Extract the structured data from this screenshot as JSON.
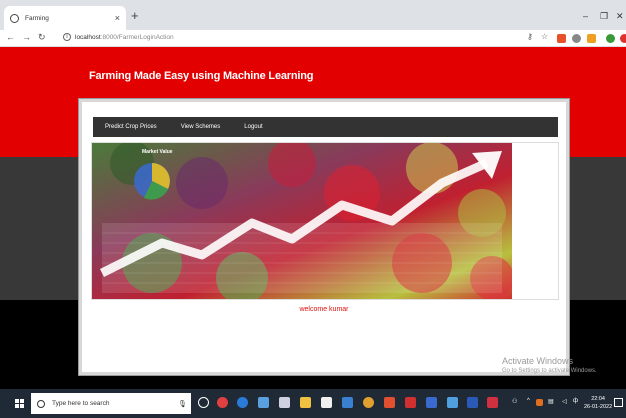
{
  "browser": {
    "tab_title": "Farming",
    "tab_close": "×",
    "new_tab": "+",
    "url_host": "localhost",
    "url_path": ":8000/FarmerLoginAction",
    "window_min": "–",
    "window_max": "❐",
    "window_close": "✕"
  },
  "site": {
    "title": "Farming Made Easy using Machine Learning",
    "nav": [
      "Predict Crop Prices",
      "View Schemes",
      "Logout"
    ],
    "hero_title": "Market Value",
    "welcome": "welcome kumar"
  },
  "windows": {
    "activate_title": "Activate Windows",
    "activate_sub": "Go to Settings to activate Windows.",
    "search_placeholder": "Type here to search",
    "time": "22:04",
    "date": "26-01-2022"
  },
  "colors": {
    "brand_red": "#e30000",
    "band_grey": "#383838",
    "menu_bg": "#333333",
    "welcome_red": "#e01010"
  }
}
